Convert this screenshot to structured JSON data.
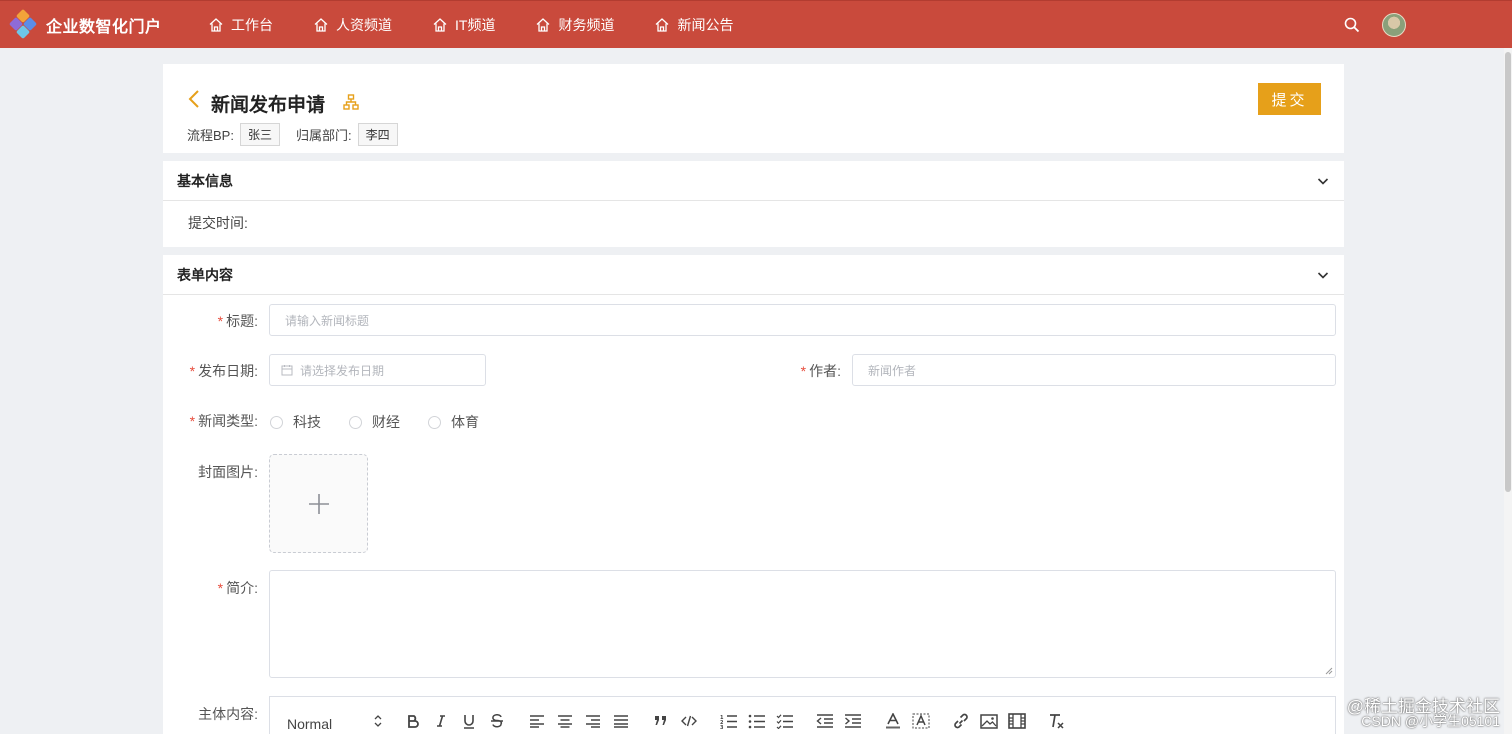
{
  "app": {
    "title": "企业数智化门户"
  },
  "nav": {
    "items": [
      {
        "label": "工作台",
        "icon": "home-icon"
      },
      {
        "label": "人资频道",
        "icon": "home-icon"
      },
      {
        "label": "IT频道",
        "icon": "home-icon"
      },
      {
        "label": "财务频道",
        "icon": "home-icon"
      },
      {
        "label": "新闻公告",
        "icon": "home-icon"
      }
    ]
  },
  "colors": {
    "brand": "#c94a3c",
    "accent": "#e6a01a",
    "required": "#e74c3c"
  },
  "page": {
    "title": "新闻发布申请",
    "submit_label": "提交",
    "meta": {
      "flow_bp_label": "流程BP:",
      "flow_bp_value": "张三",
      "dept_label": "归属部门:",
      "dept_value": "李四"
    }
  },
  "basic_info": {
    "title": "基本信息",
    "submit_time_label": "提交时间:"
  },
  "form": {
    "title": "表单内容",
    "title_label": "标题:",
    "title_placeholder": "请输入新闻标题",
    "date_label": "发布日期:",
    "date_placeholder": "请选择发布日期",
    "author_label": "作者:",
    "author_placeholder": "新闻作者",
    "type_label": "新闻类型:",
    "type_options": [
      "科技",
      "财经",
      "体育"
    ],
    "cover_label": "封面图片:",
    "summary_label": "简介:",
    "content_label": "主体内容:",
    "editor": {
      "format_value": "Normal"
    }
  },
  "watermark": {
    "line1": "@稀土掘金技术社区",
    "line2": "CSDN @小学生05101"
  }
}
